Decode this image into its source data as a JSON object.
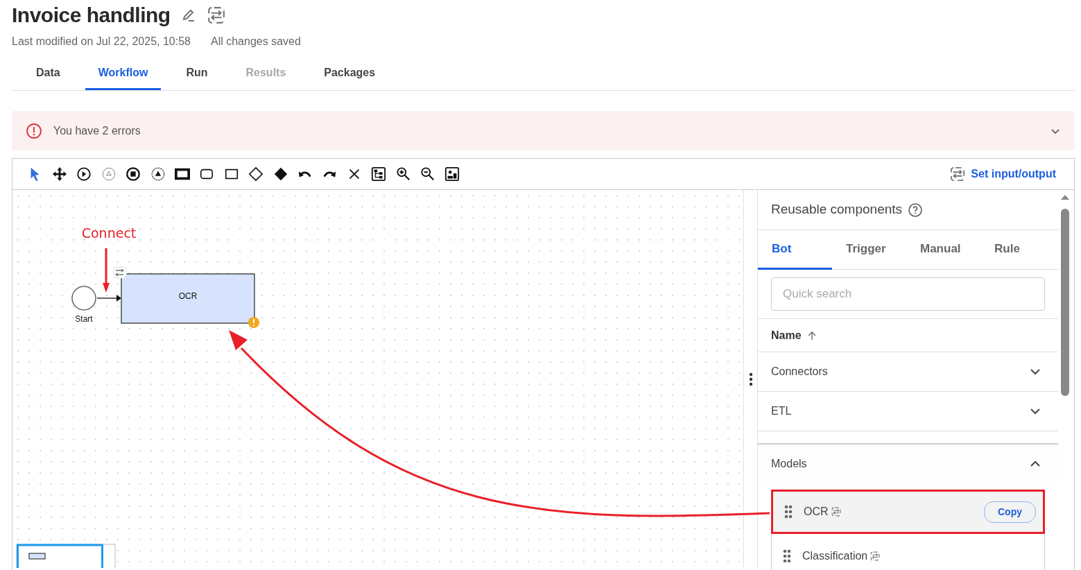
{
  "header": {
    "title": "Invoice handling",
    "last_modified": "Last modified on Jul 22, 2025, 10:58",
    "save_status": "All changes saved"
  },
  "tabs": [
    {
      "label": "Data",
      "selected": false,
      "disabled": false
    },
    {
      "label": "Workflow",
      "selected": true,
      "disabled": false
    },
    {
      "label": "Run",
      "selected": false,
      "disabled": false
    },
    {
      "label": "Results",
      "selected": false,
      "disabled": true
    },
    {
      "label": "Packages",
      "selected": false,
      "disabled": false
    }
  ],
  "alert": {
    "message": "You have 2 errors",
    "expanded": false
  },
  "toolbar": {
    "tools": [
      {
        "kind": "pointer",
        "selected": true
      },
      {
        "kind": "move",
        "selected": false
      },
      {
        "kind": "start-event",
        "selected": false
      },
      {
        "kind": "intermediate-event",
        "selected": false
      },
      {
        "kind": "end-event",
        "selected": false
      },
      {
        "kind": "escalation-event",
        "selected": false
      },
      {
        "kind": "thick-rect",
        "selected": false
      },
      {
        "kind": "rounded-rect",
        "selected": false
      },
      {
        "kind": "rect",
        "selected": false
      },
      {
        "kind": "diamond",
        "selected": false
      },
      {
        "kind": "filled-diamond",
        "selected": false
      },
      {
        "kind": "undo",
        "selected": false
      },
      {
        "kind": "redo",
        "selected": false
      },
      {
        "kind": "delete",
        "selected": false
      },
      {
        "kind": "layout",
        "selected": false
      },
      {
        "kind": "zoom-in",
        "selected": false
      },
      {
        "kind": "zoom-out",
        "selected": false
      },
      {
        "kind": "overview",
        "selected": false
      }
    ],
    "action": "Set input/output"
  },
  "canvas": {
    "nodes": [
      {
        "kind": "start",
        "label": "Start"
      },
      {
        "kind": "task",
        "label": "OCR",
        "warning": true
      }
    ],
    "annotation": {
      "label": "Connect"
    }
  },
  "components_panel": {
    "title": "Reusable components",
    "tabs": [
      {
        "label": "Bot",
        "selected": true
      },
      {
        "label": "Trigger",
        "selected": false
      },
      {
        "label": "Manual",
        "selected": false
      },
      {
        "label": "Rule",
        "selected": false
      }
    ],
    "search": {
      "placeholder": "Quick search"
    },
    "sort_column": "Name",
    "groups": [
      {
        "name": "Connectors",
        "expanded": false
      },
      {
        "name": "ETL",
        "expanded": false
      },
      {
        "name": "Models",
        "expanded": true,
        "items": [
          {
            "name": "OCR",
            "highlighted": true,
            "action": "Copy"
          },
          {
            "name": "Classification",
            "highlighted": false
          }
        ]
      }
    ]
  }
}
